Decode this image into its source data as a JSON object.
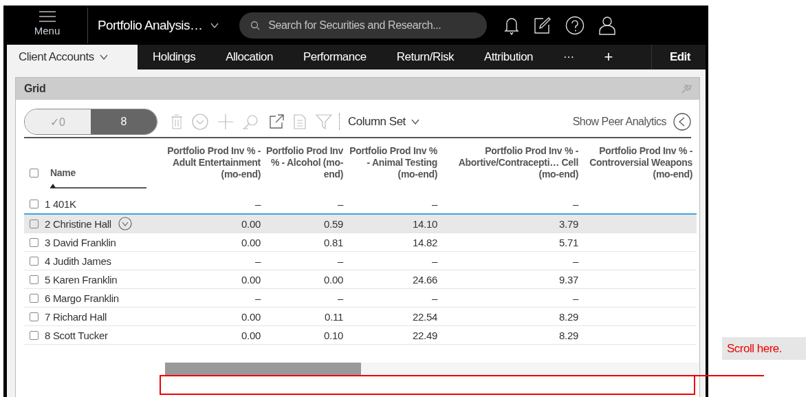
{
  "app_bar": {
    "menu_label": "Menu",
    "title": "Portfolio Analysis…",
    "search": {
      "placeholder": "Search for Securities and Research..."
    }
  },
  "tabs": [
    {
      "label": "Client Accounts",
      "selected": true,
      "kind": "dropdown"
    },
    {
      "label": "Holdings",
      "selected": false,
      "kind": "plain"
    },
    {
      "label": "Allocation",
      "selected": false,
      "kind": "plain"
    },
    {
      "label": "Performance",
      "selected": false,
      "kind": "plain"
    },
    {
      "label": "Return/Risk",
      "selected": false,
      "kind": "plain"
    },
    {
      "label": "Attribution",
      "selected": false,
      "kind": "plain"
    }
  ],
  "tab_actions": {
    "more": "···",
    "add": "+",
    "edit": "Edit"
  },
  "panel": {
    "title": "Grid",
    "toggle": [
      {
        "label": "✓0",
        "selected": false
      },
      {
        "label": "8",
        "selected": true
      }
    ],
    "column_set": "Column Set",
    "peer_analytics": "Show Peer Analytics",
    "table": {
      "select_all_checked": false,
      "columns": [
        {
          "label": "Name",
          "sorted": true
        },
        {
          "label": "Portfolio Prod Inv % - Adult Entertainment (mo-end)",
          "sorted": false
        },
        {
          "label": "Portfolio Prod Inv % - Alcohol (mo-end)",
          "sorted": false
        },
        {
          "label": "Portfolio Prod Inv % - Animal Testing (mo-end)",
          "sorted": false
        },
        {
          "label": "Portfolio Prod Inv % - Abortive/Contracepti… Cell (mo-end)",
          "sorted": false
        },
        {
          "label": "Portfolio Prod Inv % - Controversial Weapons (mo-end)",
          "sorted": false
        }
      ],
      "rows": [
        {
          "index": "1",
          "name": "401K",
          "checked": false,
          "highlighted": false,
          "values": [
            "–",
            "–",
            "–",
            "–"
          ]
        },
        {
          "index": "2",
          "name": "Christine Hall",
          "checked": false,
          "highlighted": true,
          "values": [
            "0.00",
            "0.59",
            "14.10",
            "3.79"
          ]
        },
        {
          "index": "3",
          "name": "David Franklin",
          "checked": false,
          "highlighted": false,
          "values": [
            "0.00",
            "0.81",
            "14.82",
            "5.71"
          ]
        },
        {
          "index": "4",
          "name": "Judith James",
          "checked": false,
          "highlighted": false,
          "values": [
            "–",
            "–",
            "–",
            "–"
          ]
        },
        {
          "index": "5",
          "name": "Karen Franklin",
          "checked": false,
          "highlighted": false,
          "values": [
            "0.00",
            "0.00",
            "24.66",
            "9.37"
          ]
        },
        {
          "index": "6",
          "name": "Margo Franklin",
          "checked": false,
          "highlighted": false,
          "values": [
            "–",
            "–",
            "–",
            "–"
          ]
        },
        {
          "index": "7",
          "name": "Richard Hall",
          "checked": false,
          "highlighted": false,
          "values": [
            "0.00",
            "0.11",
            "22.54",
            "8.29"
          ]
        },
        {
          "index": "8",
          "name": "Scott Tucker",
          "checked": false,
          "highlighted": false,
          "values": [
            "0.00",
            "0.10",
            "22.49",
            "8.29"
          ]
        }
      ]
    }
  },
  "annotation": {
    "text": "Scroll here."
  }
}
